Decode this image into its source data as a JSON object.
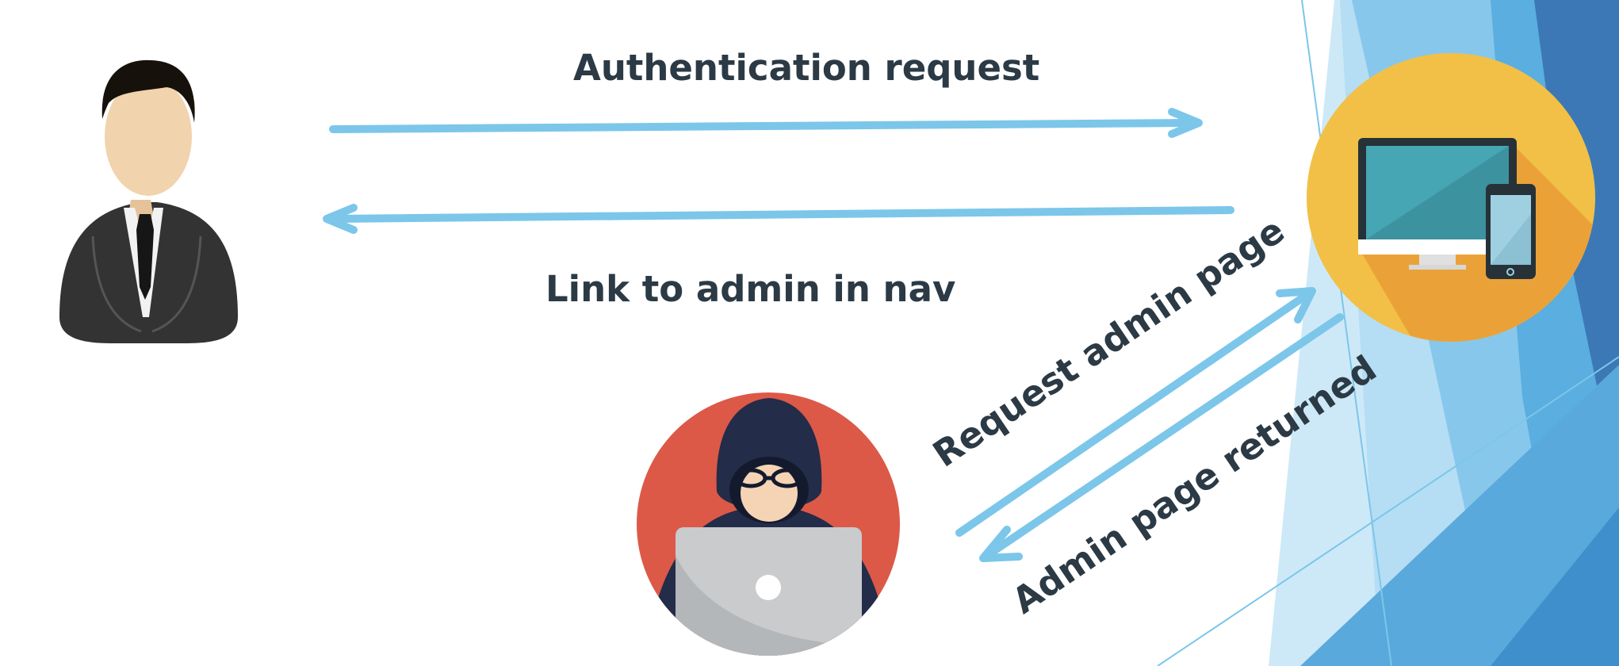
{
  "labels": {
    "authentication_request": "Authentication request",
    "link_to_admin": "Link to admin in nav",
    "request_admin_page": "Request admin page",
    "admin_page_returned": "Admin page returned"
  },
  "colors": {
    "arrow": "#7cc6ea",
    "text": "#2b3a45",
    "server_circle": "#f2c046",
    "server_shadow": "#eaa238",
    "hacker_circle": "#dc5948",
    "hood": "#232c49",
    "laptop": "#c9cbcd",
    "suit": "#333333",
    "skin": "#f1d3ad",
    "deco_light": "#cde9f7",
    "deco_mid": "#87c7ec",
    "deco_dark": "#3c78b6"
  },
  "icons": {
    "user": "businessman-icon",
    "server": "computer-devices-icon",
    "attacker": "hacker-icon"
  }
}
